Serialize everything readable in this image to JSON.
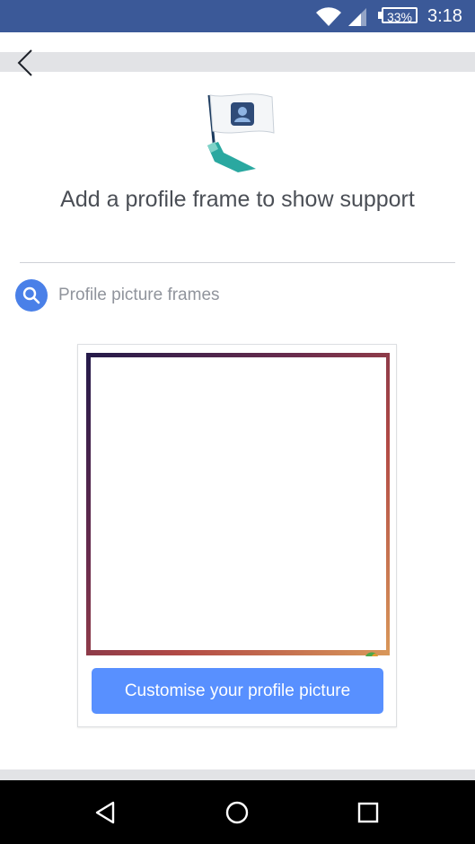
{
  "status_bar": {
    "battery": "33%",
    "time": "3:18",
    "background": "#3b5998"
  },
  "header": {
    "back_icon": "chevron-left-icon"
  },
  "illustration": {
    "icon": "profile-flag-icon"
  },
  "headline": {
    "text": "Add a profile frame to show support"
  },
  "search": {
    "icon": "search-icon",
    "label": "Profile picture frames"
  },
  "frame_card": {
    "button_label": "Customise your profile picture",
    "button_color": "#5890ff"
  },
  "nav_bar": {
    "back": "back-triangle-icon",
    "home": "home-circle-icon",
    "recents": "recents-square-icon"
  }
}
